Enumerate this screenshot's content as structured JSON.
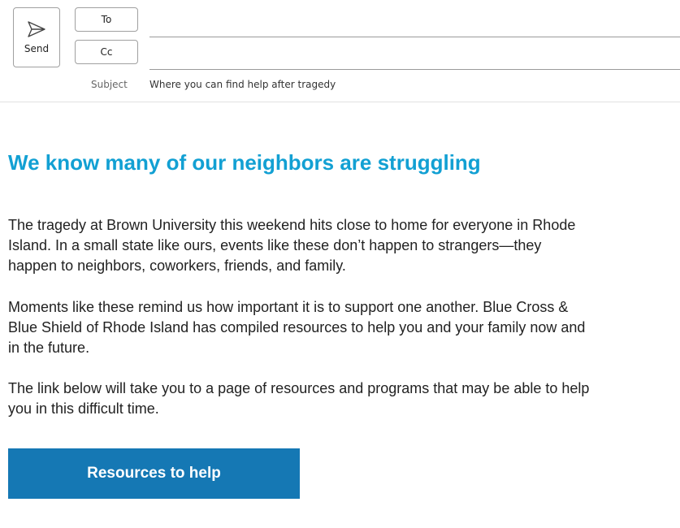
{
  "compose": {
    "send_label": "Send",
    "to_label": "To",
    "cc_label": "Cc",
    "to_value": "",
    "cc_value": "",
    "subject_label": "Subject",
    "subject_value": "Where you can find help after tragedy"
  },
  "email": {
    "headline": "We know many of our neighbors are struggling",
    "paragraphs": [
      "The tragedy at Brown University this weekend hits close to home for everyone in Rhode Island. In a small state like ours, events like these don’t happen to strangers—they happen to neighbors, coworkers, friends, and family.",
      "Moments like these remind us how important it is to support one another. Blue Cross & Blue Shield of Rhode Island has compiled resources to help you and your family now and in the future.",
      "The link below will take you to a page of resources and programs that may be able to help you in this difficult time."
    ],
    "cta_label": "Resources to help"
  },
  "colors": {
    "headline": "#12a0d3",
    "cta_background": "#1578b4",
    "cta_text": "#ffffff"
  },
  "icons": {
    "send": "send-icon"
  }
}
